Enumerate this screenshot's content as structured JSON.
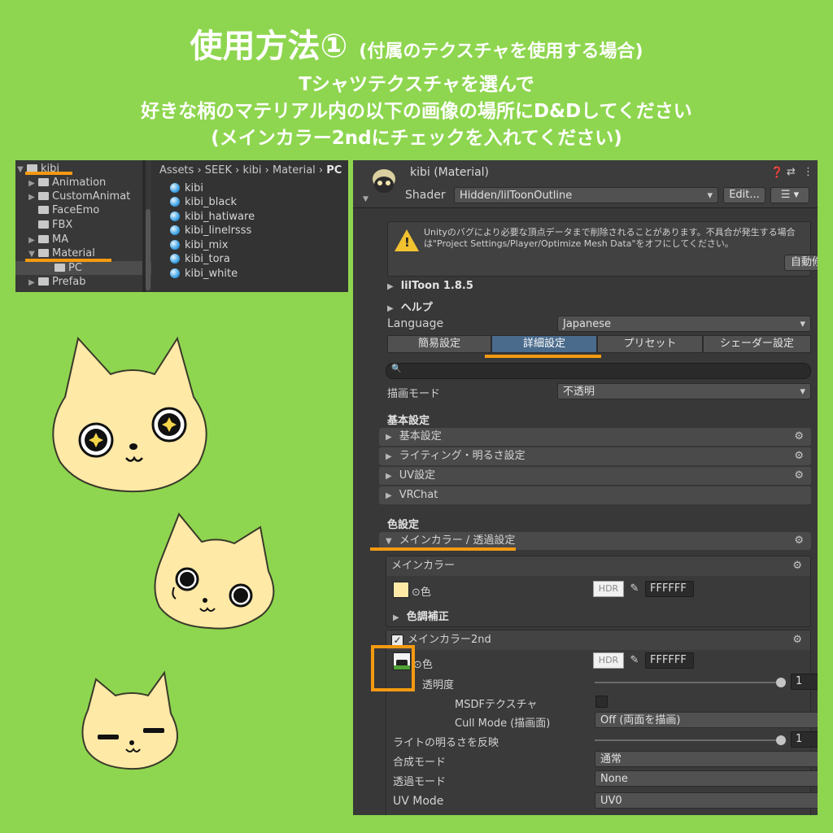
{
  "headline": {
    "title": "使用方法①",
    "title_note": "(付属のテクスチャを使用する場合)",
    "line1": "Tシャツテクスチャを選んで",
    "line2": "好きな柄のマテリアル内の以下の画像の場所にD&Dしてください",
    "line3": "(メインカラー2ndにチェックを入れてください)"
  },
  "project": {
    "tree": [
      {
        "label": "kibi",
        "expanded": true
      },
      {
        "label": "Animation",
        "expanded": false
      },
      {
        "label": "CustomAnimat",
        "expanded": false
      },
      {
        "label": "FaceEmo",
        "expanded": false
      },
      {
        "label": "FBX",
        "expanded": false
      },
      {
        "label": "MA",
        "expanded": false
      },
      {
        "label": "Material",
        "expanded": true
      },
      {
        "label": "PC",
        "expanded": false
      },
      {
        "label": "Prefab",
        "expanded": false
      }
    ],
    "breadcrumb": [
      "Assets",
      "SEEK",
      "kibi",
      "Material",
      "PC"
    ],
    "files": [
      "kibi",
      "kibi_black",
      "kibi_hatiware",
      "kibi_linelrsss",
      "kibi_mix",
      "kibi_tora",
      "kibi_white"
    ]
  },
  "inspector": {
    "title": "kibi (Material)",
    "shader_label": "Shader",
    "shader_value": "Hidden/lilToonOutline",
    "edit_label": "Edit...",
    "warning": "Unityのバグにより必要な頂点データまで削除されることがあります。不具合が発生する場合は\"Project Settings/Player/Optimize Mesh Data\"をオフにしてください。",
    "auto_fix": "自動修正",
    "version": "lilToon 1.8.5",
    "help": "ヘルプ",
    "language_label": "Language",
    "language_value": "Japanese",
    "tabs": [
      "簡易設定",
      "詳細設定",
      "プリセット",
      "シェーダー設定"
    ],
    "active_tab": "詳細設定",
    "render_mode_label": "描画モード",
    "render_mode_value": "不透明",
    "basic_header": "基本設定",
    "basic_folds": [
      "基本設定",
      "ライティング・明るさ設定",
      "UV設定",
      "VRChat"
    ],
    "color_header": "色設定",
    "main_fold": "メインカラー / 透過設定",
    "main_color": {
      "title": "メインカラー",
      "color_label": "⊙色",
      "hdr": "HDR",
      "hex": "FFFFFF",
      "adjust": "色調補正"
    },
    "main_color2": {
      "title": "メインカラー2nd",
      "enabled": true,
      "color_label": "⊙色",
      "hdr": "HDR",
      "hex": "FFFFFF",
      "opacity_label": "透明度",
      "opacity_value": "1",
      "msdf_label": "MSDFテクスチャ",
      "cull_label": "Cull Mode (描画面)",
      "cull_value": "Off (両面を描画)",
      "light_label": "ライトの明るさを反映",
      "light_value": "1",
      "blend_label": "合成モード",
      "blend_value": "通常",
      "alpha_label": "透過モード",
      "alpha_value": "None",
      "uv_label": "UV Mode",
      "uv_value": "UV0"
    }
  },
  "colors": {
    "background": "#8ed64f",
    "highlight": "#f39a11",
    "cat_face": "#ffe9a6"
  }
}
